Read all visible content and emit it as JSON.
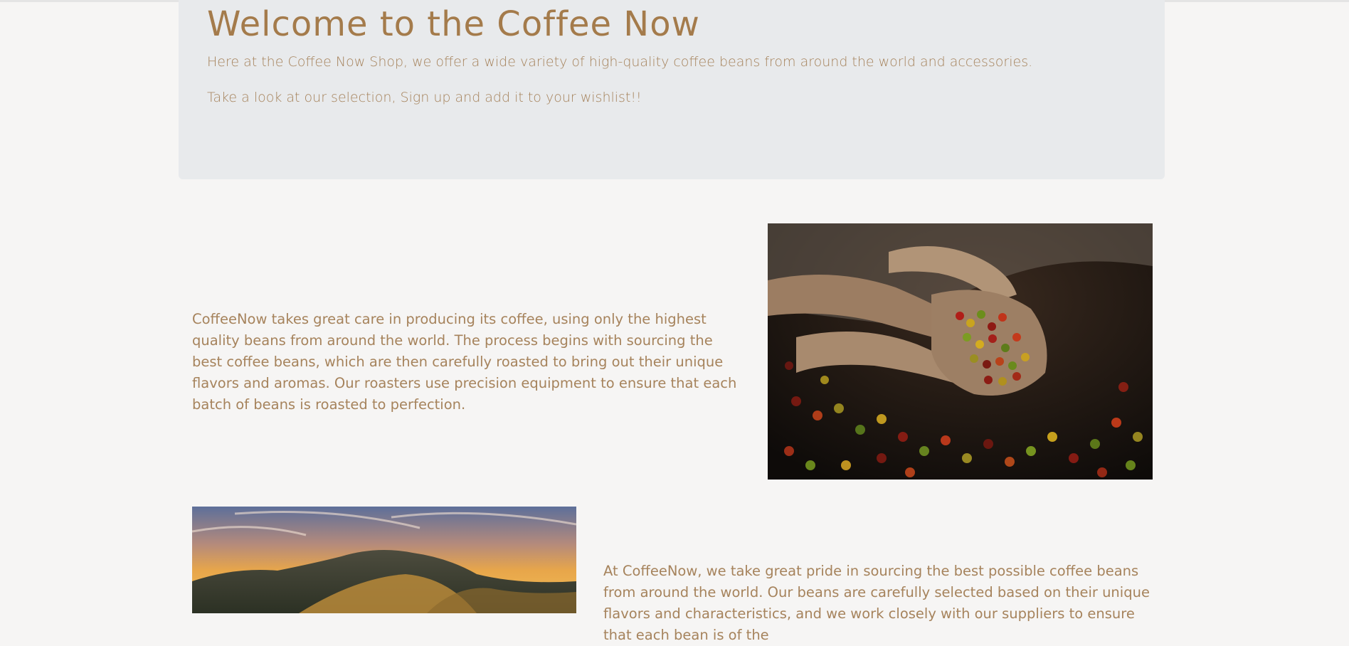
{
  "hero": {
    "title": "Welcome to the Coffee Now",
    "intro": "Here at the Coffee Now Shop, we offer a wide variety of high-quality coffee beans from around the world and accessories.",
    "cta": "Take a look at our selection, Sign up and add it to your wishlist!!"
  },
  "sections": [
    {
      "text": "CoffeeNow takes great care in producing its coffee, using only the highest quality beans from around the world. The process begins with sourcing the best coffee beans, which are then carefully roasted to bring out their unique flavors and aromas. Our roasters use precision equipment to ensure that each batch of beans is roasted to perfection."
    },
    {
      "text": "At CoffeeNow, we take great pride in sourcing the best possible coffee beans from around the world. Our beans are carefully selected based on their unique flavors and characteristics, and we work closely with our suppliers to ensure that each bean is of the"
    }
  ],
  "colors": {
    "accent": "#a47b4b",
    "text": "#a6835c",
    "hero_background": "#e8eaec",
    "page_background": "#f6f5f4"
  }
}
